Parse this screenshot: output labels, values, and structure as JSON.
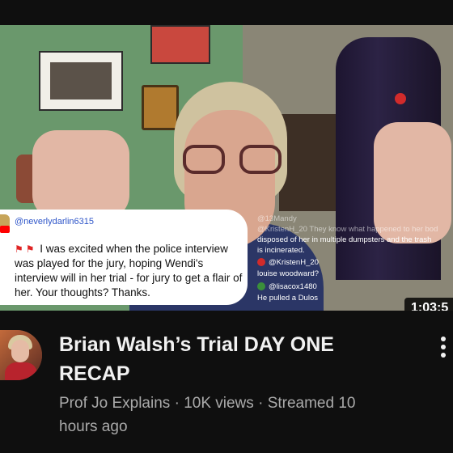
{
  "thumbnail": {
    "comment": {
      "username": "@neverlydarlin6315",
      "text": "I was excited when the police interview was played for the jury, hoping Wendi's interview will in her trial - for jury to get a flair of her. Your thoughts? Thanks."
    },
    "live_chat": [
      {
        "user": "@13Mandy",
        "message": "",
        "faded": true
      },
      {
        "user": "@KristenH_20",
        "message": "They know what happened to her bod",
        "faded": true
      },
      {
        "user": "",
        "message": "disposed of her in multiple dumpsters and the trash",
        "faded": false
      },
      {
        "user": "",
        "message": "is incinerated.",
        "faded": false
      },
      {
        "user": "@KristenH_20",
        "message": "",
        "faded": false
      },
      {
        "user": "",
        "message": "louise woodward?",
        "faded": false
      },
      {
        "user": "@lisacox1480",
        "message": "",
        "faded": false
      },
      {
        "user": "",
        "message": "He pulled a Dulos",
        "faded": false
      }
    ],
    "duration": "1:03:5"
  },
  "video": {
    "title_line1": "Brian Walsh’s Trial DAY ONE",
    "title_line2": "RECAP",
    "channel": "Prof Jo Explains",
    "separator": "·",
    "views": "10K views",
    "streamed": "Streamed 10",
    "streamed_line2": "hours ago"
  },
  "icons": {
    "more": "more-vert-icon",
    "flag": "red-flag-icon"
  },
  "colors": {
    "background": "#0f0f0f",
    "title": "#f1f1f1",
    "secondary_text": "#aaaaaa",
    "handle": "#2f56c9"
  }
}
